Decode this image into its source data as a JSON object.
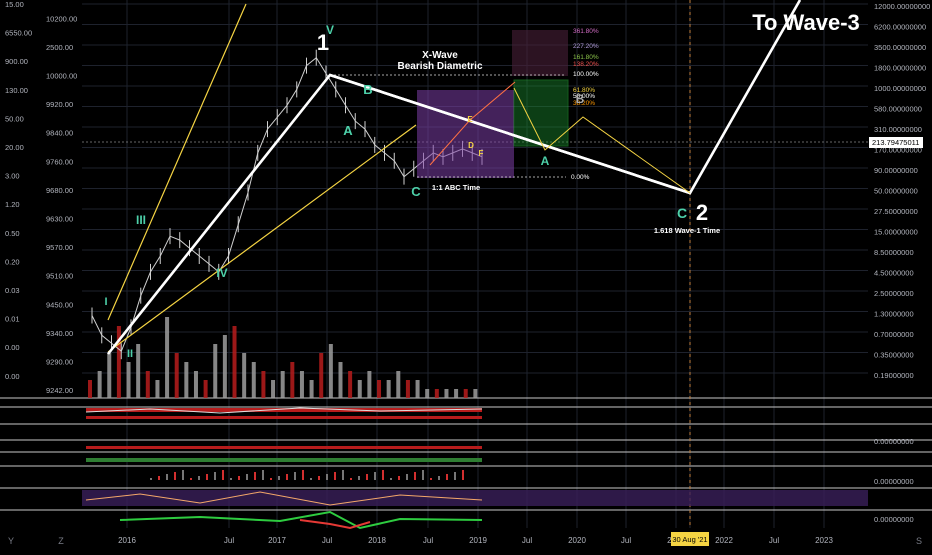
{
  "chart_data": {
    "type": "line",
    "title": "To Wave-3",
    "x_ticks": [
      "2016",
      "Jul",
      "2017",
      "Jul",
      "2018",
      "Jul",
      "2019",
      "Jul",
      "2020",
      "Jul",
      "2021",
      "30 Aug '21",
      "2022",
      "Jul",
      "2023"
    ],
    "left_axis_ticks": [
      "15.00",
      "10200.00",
      "6550.00",
      "2500.00",
      "900.00",
      "10000.00",
      "130.00",
      "9920.00",
      "50.00",
      "9840.00",
      "20.00",
      "9760.00",
      "3.00",
      "9680.00",
      "1.20",
      "9630.00",
      "0.50",
      "9570.00",
      "0.20",
      "9510.00",
      "0.03",
      "9450.00",
      "0.01",
      "9340.00",
      "0.00",
      "9290.00",
      "0.00",
      "9242.00"
    ],
    "right_axis_ticks": [
      "12000.00000000",
      "6200.00000000",
      "3500.00000000",
      "1800.00000000",
      "1000.00000000",
      "580.00000000",
      "310.00000000",
      "170.00000000",
      "90.00000000",
      "50.00000000",
      "27.50000000",
      "15.00000000",
      "8.50000000",
      "4.50000000",
      "2.50000000",
      "1.30000000",
      "0.70000000",
      "0.35000000",
      "0.19000000"
    ],
    "sub_axis_ticks": [
      "0.00000000",
      "0.00000000",
      "0.00000000"
    ],
    "price_label": "213.79475011",
    "wave_labels": [
      "1",
      "V",
      "III",
      "IV",
      "I",
      "II",
      "A",
      "B",
      "C",
      "2",
      "A",
      "B",
      "C",
      "D",
      "E",
      "F"
    ],
    "fib_labels": [
      "361.80%",
      "227.20%",
      "161.80%",
      "138.20%",
      "100.00%",
      "61.80%",
      "50.00%",
      "38.20%",
      "0.00%"
    ],
    "annotations": [
      "X-Wave",
      "Bearish Diametric",
      "1:1 ABC Time",
      "1.618 Wave-1 Time",
      "To Wave-3"
    ],
    "main_path": [
      {
        "x": "2015-09",
        "y": 9340
      },
      {
        "x": "2018-01",
        "y": 10100
      },
      {
        "x": "2020-10",
        "y": 9770
      },
      {
        "x": "2021-08",
        "y": 9760
      },
      {
        "x": "2022-08",
        "y": 10300
      }
    ],
    "price_series": [
      9450,
      9400,
      9380,
      9360,
      9420,
      9500,
      9560,
      9600,
      9650,
      9640,
      9620,
      9600,
      9580,
      9560,
      9600,
      9680,
      9760,
      9860,
      9920,
      9950,
      9980,
      10020,
      10080,
      10100,
      10060,
      10020,
      9980,
      9940,
      9920,
      9880,
      9860,
      9840,
      9800,
      9820,
      9840,
      9860,
      9850,
      9860,
      9870,
      9860,
      9850
    ],
    "volume": [
      2,
      3,
      5,
      8,
      4,
      6,
      3,
      2,
      9,
      5,
      4,
      3,
      2,
      6,
      7,
      8,
      5,
      4,
      3,
      2,
      3,
      4,
      3,
      2,
      5,
      6,
      4,
      3,
      2,
      3,
      2,
      2,
      3,
      2,
      2,
      1,
      1,
      1,
      1,
      1,
      1
    ],
    "grid": true,
    "legend": "none"
  },
  "ui": {
    "corner_left": "Y",
    "corner_left2": "Z",
    "corner_right": "S"
  },
  "colors": {
    "background": "#000000",
    "grid": "#1e222d",
    "main_path": "#ffffff",
    "yellow": "#f5d443",
    "teal": "#4dd0a9",
    "red": "#b71c1c",
    "purple_box": "#7b3ea6",
    "green_box": "#1b8a2f"
  }
}
